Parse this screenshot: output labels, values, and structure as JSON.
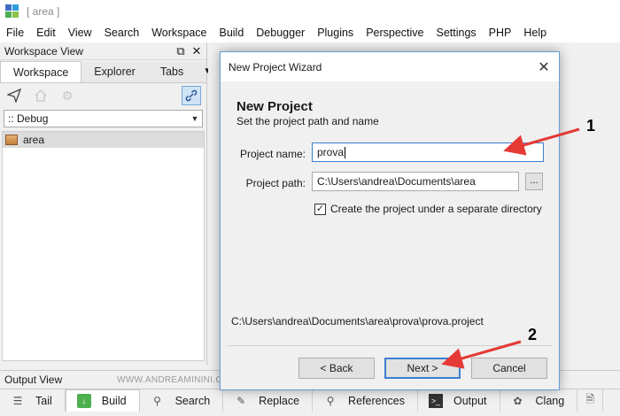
{
  "window": {
    "title": "[ area ]"
  },
  "menu": [
    "File",
    "Edit",
    "View",
    "Search",
    "Workspace",
    "Build",
    "Debugger",
    "Plugins",
    "Perspective",
    "Settings",
    "PHP",
    "Help"
  ],
  "workspace_view": {
    "title": "Workspace View",
    "tabs": [
      "Workspace",
      "Explorer",
      "Tabs"
    ],
    "active_tab": "Workspace",
    "config": ":: Debug",
    "tree": [
      {
        "label": "area",
        "icon": "workspace-icon"
      }
    ]
  },
  "output_view": {
    "title": "Output View",
    "watermark": "WWW.ANDREAMININI.COM",
    "tabs": [
      {
        "label": "Tail",
        "icon": "list-icon"
      },
      {
        "label": "Build",
        "icon": "build-icon"
      },
      {
        "label": "Search",
        "icon": "magnifier-icon"
      },
      {
        "label": "Replace",
        "icon": "pencil-icon"
      },
      {
        "label": "References",
        "icon": "magnifier-icon"
      },
      {
        "label": "Output",
        "icon": "terminal-icon"
      },
      {
        "label": "Clang",
        "icon": "clang-icon"
      }
    ],
    "active_tab": "Build"
  },
  "dialog": {
    "title": "New Project Wizard",
    "heading": "New Project",
    "subheading": "Set the project path and name",
    "name_label": "Project name:",
    "name_value": "prova",
    "path_label": "Project path:",
    "path_value": "C:\\Users\\andrea\\Documents\\area",
    "browse_label": "...",
    "checkbox_label": "Create the project under a separate directory",
    "checkbox_checked": true,
    "result_path": "C:\\Users\\andrea\\Documents\\area\\prova\\prova.project",
    "back_label": "< Back",
    "next_label": "Next >",
    "cancel_label": "Cancel"
  },
  "annotations": {
    "one": "1",
    "two": "2",
    "color": "#e53935"
  }
}
